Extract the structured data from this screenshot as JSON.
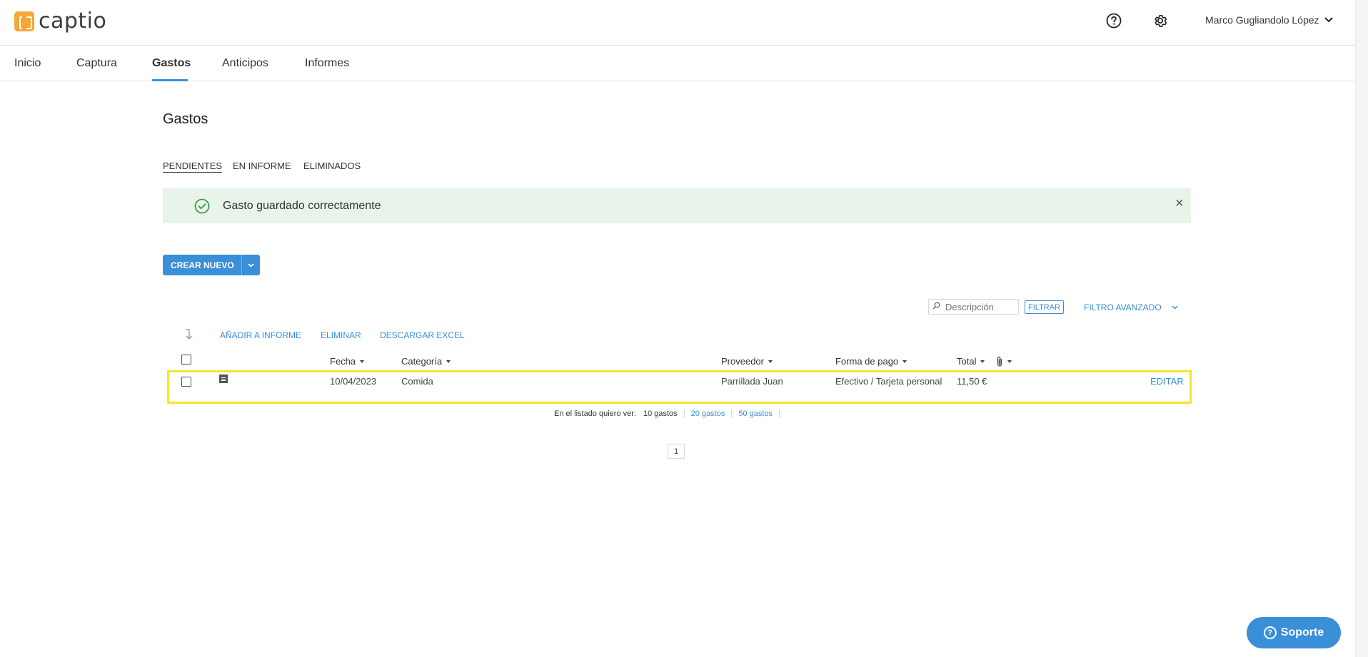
{
  "app": {
    "logo_text": "captio"
  },
  "header": {
    "help_icon": "help-circle-icon",
    "settings_icon": "gear-icon",
    "user_name": "Marco Gugliandolo López"
  },
  "nav": {
    "items": [
      {
        "label": "Inicio",
        "active": false
      },
      {
        "label": "Captura",
        "active": false
      },
      {
        "label": "Gastos",
        "active": true
      },
      {
        "label": "Anticipos",
        "active": false
      },
      {
        "label": "Informes",
        "active": false
      }
    ]
  },
  "page": {
    "title": "Gastos"
  },
  "subtabs": [
    {
      "label": "PENDIENTES",
      "active": true
    },
    {
      "label": "EN INFORME",
      "active": false
    },
    {
      "label": "ELIMINADOS",
      "active": false
    }
  ],
  "alert": {
    "message": "Gasto guardado correctamente",
    "close": "×"
  },
  "create_button": {
    "label": "CREAR NUEVO"
  },
  "filter": {
    "search_placeholder": "Descripción",
    "filter_label": "FILTRAR",
    "advanced_label": "FILTRO AVANZADO"
  },
  "actions": {
    "add_to_report": "AÑADIR A INFORME",
    "delete": "ELIMINAR",
    "download_excel": "DESCARGAR EXCEL"
  },
  "table": {
    "columns": {
      "date": "Fecha",
      "category": "Categoría",
      "provider": "Proveedor",
      "payment": "Forma de pago",
      "total": "Total"
    },
    "rows": [
      {
        "date": "10/04/2023",
        "category": "Comida",
        "provider": "Parrillada Juan",
        "payment": "Efectivo / Tarjeta personal",
        "total": "11,50 €",
        "action": "EDITAR"
      }
    ]
  },
  "pagination": {
    "label": "En el listado quiero ver:",
    "options": [
      "10 gastos",
      "20 gastos",
      "50 gastos"
    ],
    "selected": "10 gastos",
    "current_page": "1"
  },
  "support": {
    "label": "Soporte"
  },
  "colors": {
    "accent": "#3a8fd9",
    "logo": "#f4a83a",
    "success_bg": "#e8f3ea",
    "highlight": "#f5e52a"
  }
}
